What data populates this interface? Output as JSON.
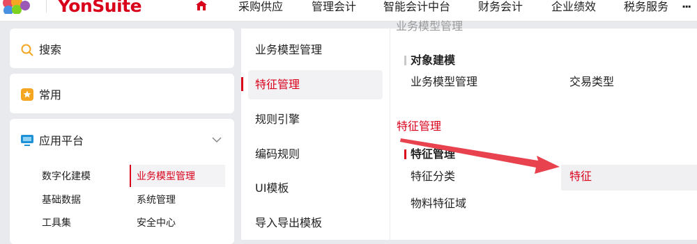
{
  "brand": {
    "name": "YonSuite"
  },
  "topnav": {
    "home_icon": "home-icon",
    "items": [
      "采购供应",
      "管理会计",
      "智能会计中台",
      "财务会计",
      "企业绩效",
      "税务服务"
    ],
    "more": "···"
  },
  "left": {
    "search_label": "搜索",
    "favorites_label": "常用",
    "platform_label": "应用平台",
    "platform_items": [
      {
        "label": "数字化建模"
      },
      {
        "label": "业务模型管理"
      },
      {
        "label": "基础数据"
      },
      {
        "label": "系统管理"
      },
      {
        "label": "工具集"
      },
      {
        "label": "安全中心"
      }
    ]
  },
  "middle": {
    "items": [
      "业务模型管理",
      "特征管理",
      "规则引擎",
      "编码规则",
      "UI模板",
      "导入导出模板"
    ],
    "active": "特征管理"
  },
  "right": {
    "clipped_heading": "业务模型管理",
    "sections": [
      {
        "heading": "对象建模",
        "items": [
          "业务模型管理",
          "交易类型"
        ]
      },
      {
        "group_title": "特征管理",
        "heading": "特征管理",
        "items": [
          "特征分类",
          "特征",
          "物料特征域"
        ]
      }
    ]
  },
  "colors": {
    "brand_red": "#d9001b",
    "bar_gray": "#c8c8c8",
    "highlight": "#f0f0f2"
  }
}
